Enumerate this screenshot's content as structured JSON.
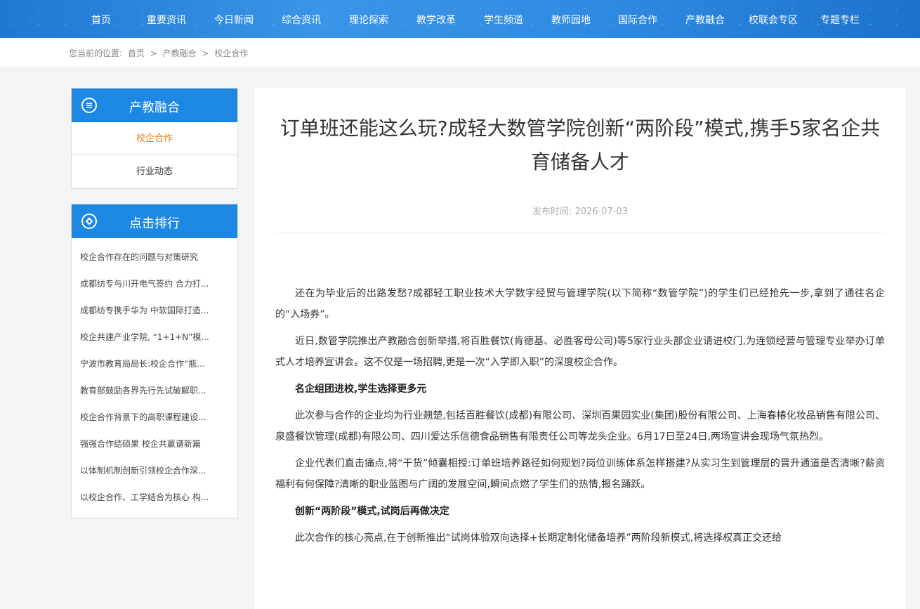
{
  "nav": {
    "items": [
      "首页",
      "重要资讯",
      "今日新闻",
      "综合资讯",
      "理论探索",
      "教学改革",
      "学生频道",
      "教师园地",
      "国际合作",
      "产教融合",
      "校联会专区",
      "专题专栏"
    ]
  },
  "breadcrumb": {
    "prefix": "您当前的位置:",
    "home": "首页",
    "sep": ">",
    "level1": "产教融合",
    "level2": "校企合作"
  },
  "sidebar": {
    "category": {
      "title": "产教融合",
      "items": [
        "校企合作",
        "行业动态"
      ]
    },
    "ranking": {
      "title": "点击排行",
      "items": [
        "校企合作存在的问题与对策研究",
        "成都纺专与川开电气签约 合力打...",
        "成都纺专携手华为 中软国际打造...",
        "校企共建产业学院, “1+1+N”模...",
        "宁波市教育局局长:校企合作“瓶...",
        "教育部鼓励各界先行先试破解职...",
        "校企合作背景下的高职课程建设...",
        "强强合作结硕果 校企共赢谱新篇",
        "以体制机制创新引领校企合作深...",
        "以校企合作、工学结合为核心 构..."
      ]
    }
  },
  "article": {
    "title": "订单班还能这么玩?成轻大数管学院创新“两阶段”模式,携手5家名企共育储备人才",
    "publish_label": "发布时间:",
    "publish_date": "2026-07-03",
    "p1": "还在为毕业后的出路发愁?成都轻工职业技术大学数字经贸与管理学院(以下简称“数管学院”)的学生们已经抢先一步,拿到了通往名企的“入场券”。",
    "p2": "近日,数管学院推出产教融合创新举措,将百胜餐饮(肯德基、必胜客母公司)等5家行业头部企业请进校门,为连锁经营与管理专业举办订单式人才培养宣讲会。这不仅是一场招聘,更是一次“入学即入职”的深度校企合作。",
    "h1": "名企组团进校,学生选择更多元",
    "p3": "此次参与合作的企业均为行业翘楚,包括百胜餐饮(成都)有限公司、深圳百果园实业(集团)股份有限公司、上海春椿化妆品销售有限公司、泉盛餐饮管理(成都)有限公司、四川爱达乐信德食品销售有限责任公司等龙头企业。6月17日至24日,两场宣讲会现场气氛热烈。",
    "p4": "企业代表们直击痛点,将“干货”倾囊相授:订单班培养路径如何规划?岗位训练体系怎样搭建?从实习生到管理层的晋升通道是否清晰?薪资福利有何保障?清晰的职业蓝图与广阔的发展空间,瞬间点燃了学生们的热情,报名踊跃。",
    "h2": "创新“两阶段”模式,试岗后再做决定",
    "p5": "此次合作的核心亮点,在于创新推出“试岗体验双向选择+长期定制化储备培养”两阶段新模式,将选择权真正交还给"
  }
}
